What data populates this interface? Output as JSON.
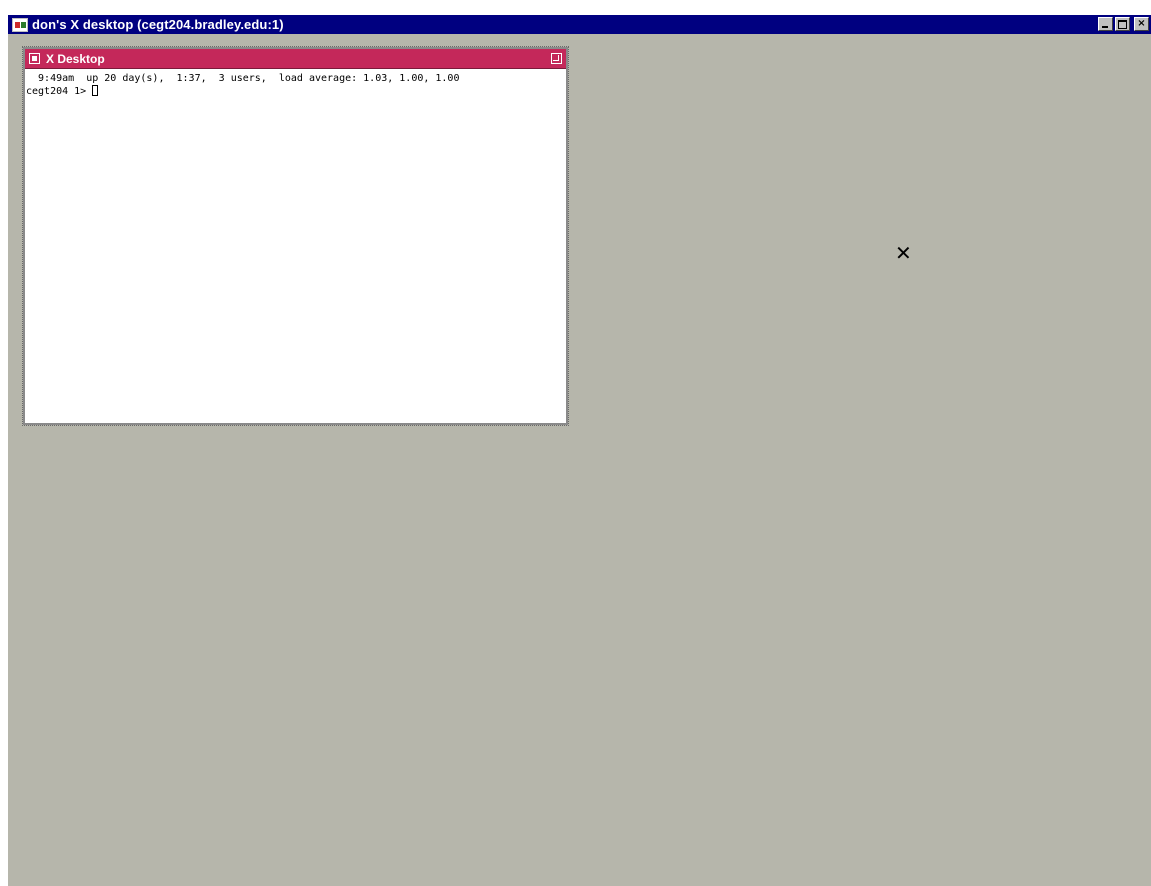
{
  "outer_window": {
    "title": "don's X desktop (cegt204.bradley.edu:1)",
    "icon": "xwin32-app-icon",
    "controls": {
      "minimize": "minimize",
      "maximize": "maximize",
      "close": "×"
    },
    "desktop_color": "#b6b6ab",
    "titlebar_color": "#000080"
  },
  "inner_window": {
    "title": "X Desktop",
    "titlebar_color": "#c4285a",
    "terminal": {
      "line1": "  9:49am  up 20 day(s),  1:37,  3 users,  load average: 1.03, 1.00, 1.00",
      "prompt": "cegt204 1> "
    }
  },
  "pointer": {
    "glyph": "✕"
  }
}
